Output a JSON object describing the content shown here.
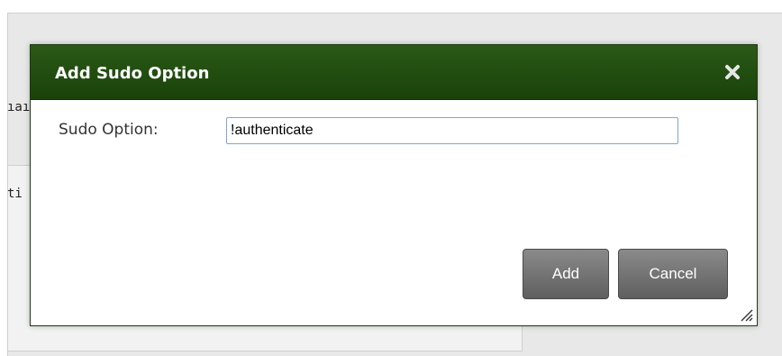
{
  "background": {
    "fragment_1": "ıaı",
    "fragment_2": "ti"
  },
  "dialog": {
    "title": "Add Sudo Option",
    "close_icon": "close-icon",
    "field": {
      "label": "Sudo Option:",
      "value": "!authenticate"
    },
    "buttons": {
      "add_label": "Add",
      "cancel_label": "Cancel"
    },
    "resize_icon": "resize-grip-icon"
  },
  "colors": {
    "header": "#1f4a0f",
    "button": "#6e6e6e",
    "input_border": "#7fa6d6"
  }
}
